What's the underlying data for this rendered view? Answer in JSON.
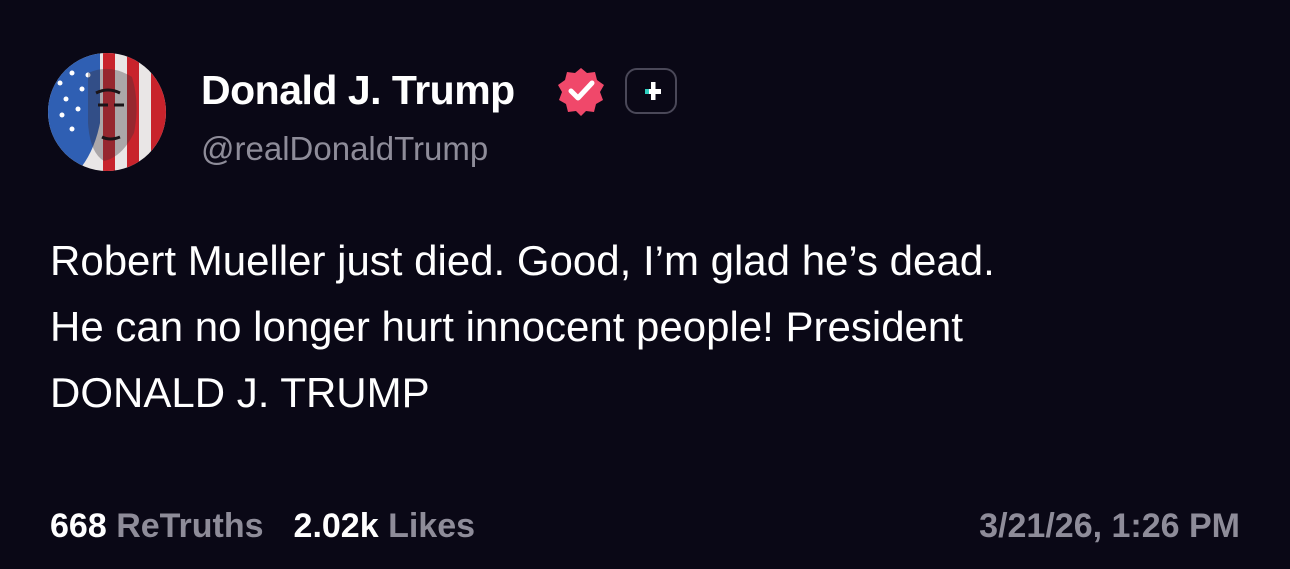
{
  "author": {
    "display_name": "Donald J. Trump",
    "handle": "@realDonaldTrump",
    "verified": true,
    "verified_badge_color": "#f0486a"
  },
  "icons": {
    "verified": "verified-badge-icon",
    "plus": "plus-icon",
    "avatar": "avatar"
  },
  "post": {
    "lines": [
      "Robert Mueller just died. Good, I’m glad he’s dead.",
      "He can no longer hurt innocent people! President",
      "DONALD J. TRUMP"
    ]
  },
  "stats": {
    "retruths_count": "668",
    "retruths_label": "ReTruths",
    "likes_count": "2.02k",
    "likes_label": "Likes"
  },
  "timestamp": "3/21/26, 1:26 PM",
  "colors": {
    "background": "#0a0816",
    "text": "#ffffff",
    "muted": "#8e8c99",
    "plus_accent": "#2fd0c0"
  }
}
